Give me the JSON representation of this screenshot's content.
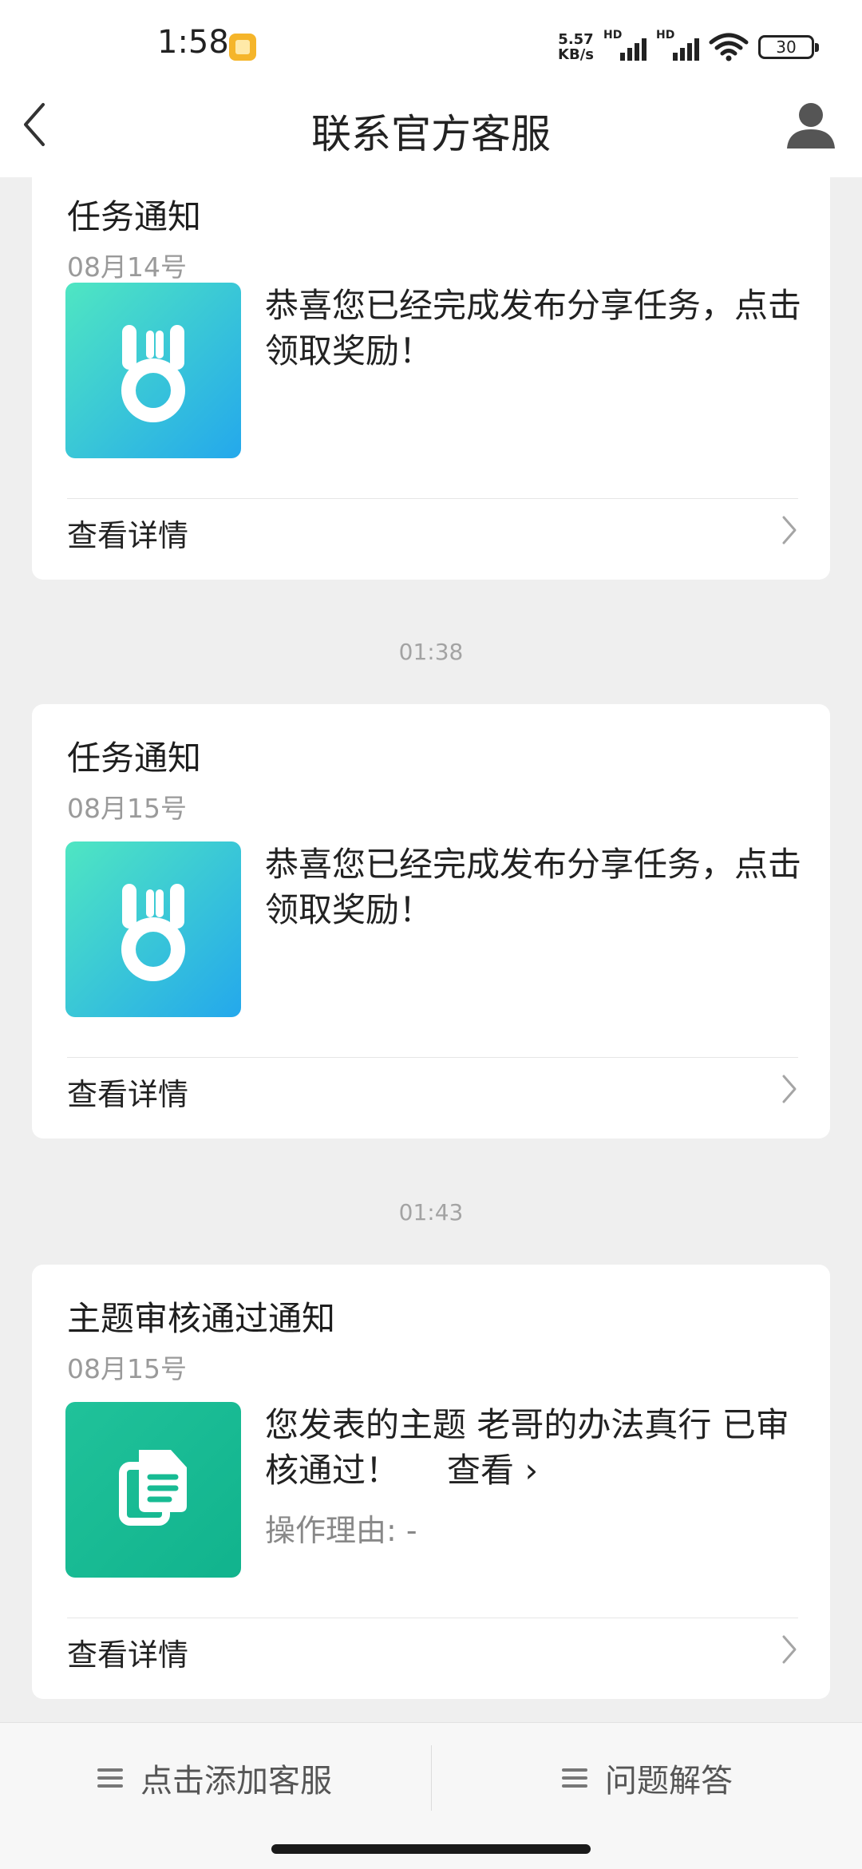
{
  "status_bar": {
    "time": "1:58",
    "net_speed_value": "5.57",
    "net_speed_unit": "KB/s",
    "sim1_label": "HD",
    "sim2_label": "HD",
    "battery": "30"
  },
  "nav": {
    "title": "联系官方客服"
  },
  "messages": [
    {
      "title": "任务通知",
      "date": "08月14号",
      "text": "恭喜您已经完成发布分享任务，点击领取奖励！",
      "detail_label": "查看详情",
      "icon": "medal-icon"
    },
    {
      "timestamp": "01:38",
      "title": "任务通知",
      "date": "08月15号",
      "text": "恭喜您已经完成发布分享任务，点击领取奖励！",
      "detail_label": "查看详情",
      "icon": "medal-icon"
    },
    {
      "timestamp": "01:43",
      "title": "主题审核通过通知",
      "date": "08月15号",
      "text": "您发表的主题 老哥的办法真行 已审核通过！",
      "link": "查看 ›",
      "reason": "操作理由: -",
      "detail_label": "查看详情",
      "icon": "document-icon"
    }
  ],
  "bottom_menu": {
    "left_label": "点击添加客服",
    "right_label": "问题解答"
  },
  "colors": {
    "medal_gradient_start": "#4fe6c2",
    "medal_gradient_end": "#24a8ec",
    "document_bg": "#17bb93",
    "page_bg": "#efefef"
  }
}
